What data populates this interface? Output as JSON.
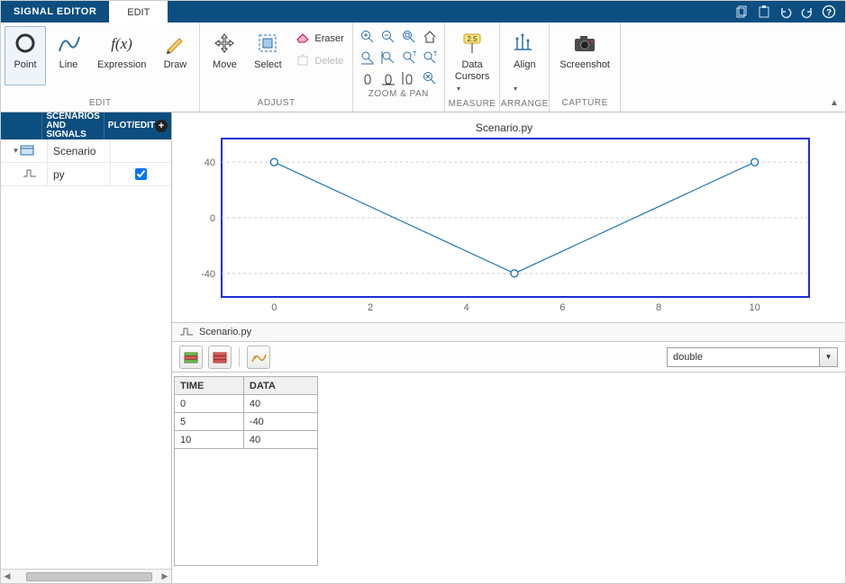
{
  "app_title": "SIGNAL EDITOR",
  "active_tab": "EDIT",
  "ribbon": {
    "groups": {
      "edit": {
        "label": "EDIT",
        "point": "Point",
        "line": "Line",
        "expression": "Expression",
        "draw": "Draw"
      },
      "adjust": {
        "label": "ADJUST",
        "move": "Move",
        "select": "Select",
        "eraser": "Eraser",
        "delete": "Delete"
      },
      "zoom": {
        "label": "ZOOM & PAN"
      },
      "measure": {
        "label": "MEASURE",
        "data_cursors": "Data\nCursors"
      },
      "arrange": {
        "label": "ARRANGE",
        "align": "Align"
      },
      "capture": {
        "label": "CAPTURE",
        "screenshot": "Screenshot"
      }
    }
  },
  "tree": {
    "col_icon_w": 52,
    "col_name_w": 70,
    "header": {
      "scenarios": "SCENARIOS AND SIGNALS",
      "plot": "PLOT/EDIT"
    },
    "rows": [
      {
        "kind": "scenario",
        "name": "Scenario",
        "plot_checked": null
      },
      {
        "kind": "signal",
        "name": "py",
        "plot_checked": true
      }
    ]
  },
  "chart_data": {
    "type": "line",
    "title": "Scenario.py",
    "x": [
      0,
      5,
      10
    ],
    "y": [
      40,
      -40,
      40
    ],
    "xticks": [
      0,
      2,
      4,
      6,
      8,
      10
    ],
    "yticks": [
      -40,
      0,
      40
    ],
    "xlim": [
      -1,
      11
    ],
    "ylim": [
      -55,
      55
    ],
    "marker": "circle",
    "line_color": "#1f77b4",
    "selected": true
  },
  "signal_tab": "Scenario.py",
  "datatype_selected": "double",
  "table": {
    "columns": [
      "TIME",
      "DATA"
    ],
    "rows": [
      [
        "0",
        "40"
      ],
      [
        "5",
        "-40"
      ],
      [
        "10",
        "40"
      ]
    ]
  }
}
